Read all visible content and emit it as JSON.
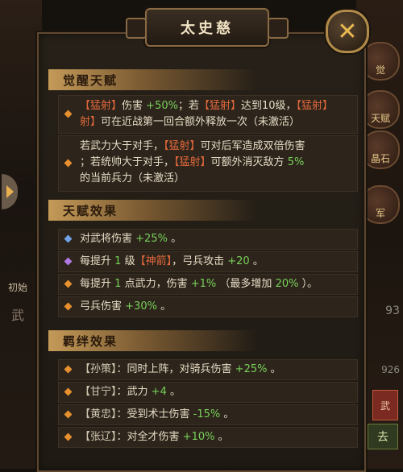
{
  "window": {
    "title": "太史慈"
  },
  "side_buttons": [
    "觉",
    "天赋",
    "晶石",
    "军",
    "初始"
  ],
  "left_numbers": [
    "武"
  ],
  "right_numbers": [
    "93",
    "926"
  ],
  "right_buttons": {
    "red": "武",
    "green": "去"
  },
  "sections": {
    "awaken": {
      "title": "觉醒天赋",
      "items": [
        {
          "line1_a": "【猛射】",
          "line1_b": "伤害",
          "line1_c": "+50%",
          "line1_d": "；若",
          "line1_e": "【猛射】",
          "line1_f": "达到10级，",
          "line1_g": "【猛射】",
          "line2_a": "射】",
          "line2_b": "可在近战第一回合额外释放一次（未激活）"
        },
        {
          "line1_a": "若武力大于对手，",
          "line1_b": "【猛射】",
          "line1_c": "可对后军造成双倍伤害",
          "line2_a": "；若统帅大于对手，",
          "line2_b": "【猛射】",
          "line2_c": "可额外消灭敌方",
          "line2_d": "5%",
          "line3": "的当前兵力（未激活）"
        }
      ]
    },
    "talent": {
      "title": "天赋效果",
      "items": [
        {
          "a": "对武将伤害",
          "b": "+25%",
          "c": "。"
        },
        {
          "a": "每提升",
          "b": "1",
          "c": "级",
          "d": "【神箭】",
          "e": "，弓兵攻击",
          "f": "+20",
          "g": "。"
        },
        {
          "a": "每提升",
          "b": "1",
          "c": "点武力，伤害",
          "d": "+1%",
          "e": "（最多增加",
          "f": "20%",
          "g": "）。"
        },
        {
          "a": "弓兵伤害",
          "b": "+30%",
          "c": "。"
        }
      ]
    },
    "bond": {
      "title": "羁绊效果",
      "items": [
        {
          "name": "【孙策】",
          "a": "：同时上阵，对骑兵伤害",
          "b": "+25%",
          "c": "。"
        },
        {
          "name": "【甘宁】",
          "a": "：武力",
          "b": "+4",
          "c": "。"
        },
        {
          "name": "【黄忠】",
          "a": "：受到术士伤害",
          "b": "-15%",
          "c": "。"
        },
        {
          "name": "【张辽】",
          "a": "：对全才伤害",
          "b": "+10%",
          "c": "。"
        }
      ]
    }
  },
  "colors": {
    "highlight": "#e0673c",
    "positive": "#78d05a",
    "diamond_orange": "#e8902e",
    "diamond_blue": "#6fa2e6",
    "diamond_purple": "#b07ae0"
  }
}
